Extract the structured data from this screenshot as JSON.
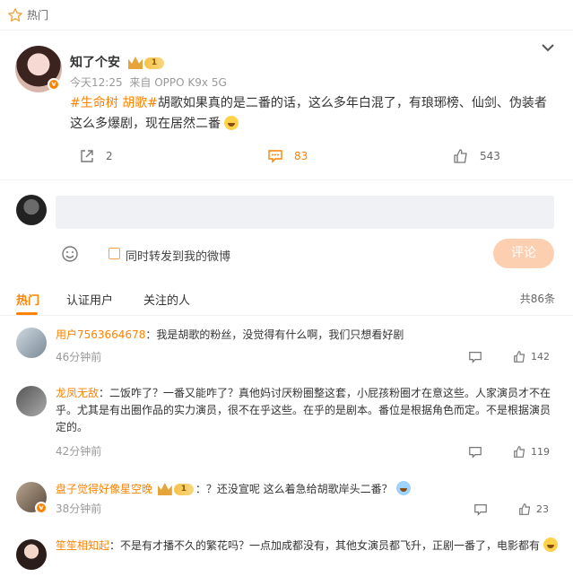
{
  "header": {
    "section_label": "热门"
  },
  "post": {
    "username": "知了个安",
    "level_badge": "1",
    "verified_badge": "v",
    "time": "今天12:25",
    "source": "来自 OPPO K9x 5G",
    "tags": [
      "#生命树",
      "胡歌#"
    ],
    "text": "胡歌如果真的是二番的话，这么多年白混了，有琅琊榜、仙剑、伪装者这么多爆剧，现在居然二番",
    "actions": {
      "repost": "2",
      "comment": "83",
      "like": "543"
    }
  },
  "compose": {
    "placeholder": "",
    "sync_label": "同时转发到我的微博",
    "submit_label": "评论"
  },
  "comment_tabs": {
    "tabs": [
      "热门",
      "认证用户",
      "关注的人"
    ],
    "total": "共86条"
  },
  "comments": [
    {
      "nick": "用户7563664678",
      "text": "：我是胡歌的粉丝，没觉得有什么啊，我们只想看好剧",
      "time": "46分钟前",
      "likes": "142"
    },
    {
      "nick": "龙凤无敌",
      "text": "：二饭咋了？一番又能咋了？真他妈讨厌粉圈整这套，小屁孩粉圈才在意这些。人家演员才不在乎。尤其是有出圈作品的实力演员，很不在乎这些。在乎的是剧本。番位是根据角色而定。不是根据演员定的。",
      "time": "42分钟前",
      "likes": "119"
    },
    {
      "nick": "盘子觉得好像星空晚",
      "level_badge": "1",
      "text": "：？还没宣呢 这么着急给胡歌岸头二番？",
      "time": "38分钟前",
      "likes": "23"
    },
    {
      "nick": "笙笙相知起",
      "text": "：不是有才播不久的繁花吗？一点加成都没有，其他女演员都飞升，正剧一番了，电影都有"
    }
  ],
  "colors": {
    "accent": "#ff8200",
    "muted": "#999999",
    "input_bg": "#f0f1f4",
    "submit_bg": "#fccfb0"
  }
}
